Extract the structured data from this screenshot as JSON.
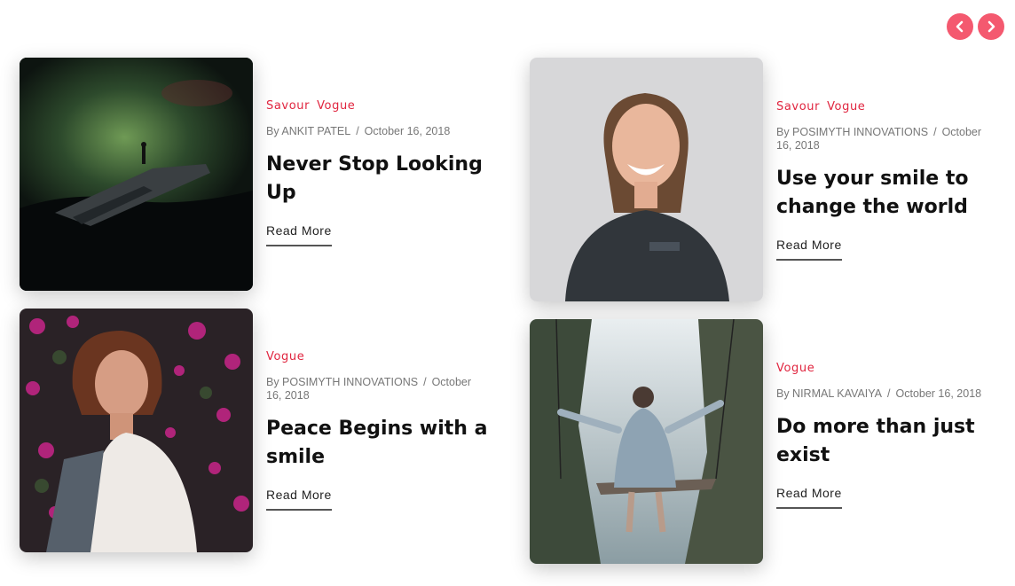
{
  "nav": {
    "prev_icon": "chevron-left-icon",
    "next_icon": "chevron-right-icon",
    "accent": "#f4596f"
  },
  "posts": [
    {
      "categories": [
        "Savour",
        "Vogue"
      ],
      "author": "By ANKIT PATEL",
      "date": "October 16, 2018",
      "title": "Never Stop Looking Up",
      "read_more": "Read More"
    },
    {
      "categories": [
        "Savour",
        "Vogue"
      ],
      "author": "By POSIMYTH INNOVATIONS",
      "date": "October 16, 2018",
      "title": "Use your smile to change the world",
      "read_more": "Read More"
    },
    {
      "categories": [
        "Vogue"
      ],
      "author": "By POSIMYTH INNOVATIONS",
      "date": "October 16, 2018",
      "title": "Peace Begins with a smile",
      "read_more": "Read More"
    },
    {
      "categories": [
        "Vogue"
      ],
      "author": "By NIRMAL KAVAIYA",
      "date": "October 16, 2018",
      "title": "Do more than just exist",
      "read_more": "Read More"
    }
  ],
  "colors": {
    "category": "#e0253f",
    "meta": "#777777",
    "title": "#111111"
  }
}
